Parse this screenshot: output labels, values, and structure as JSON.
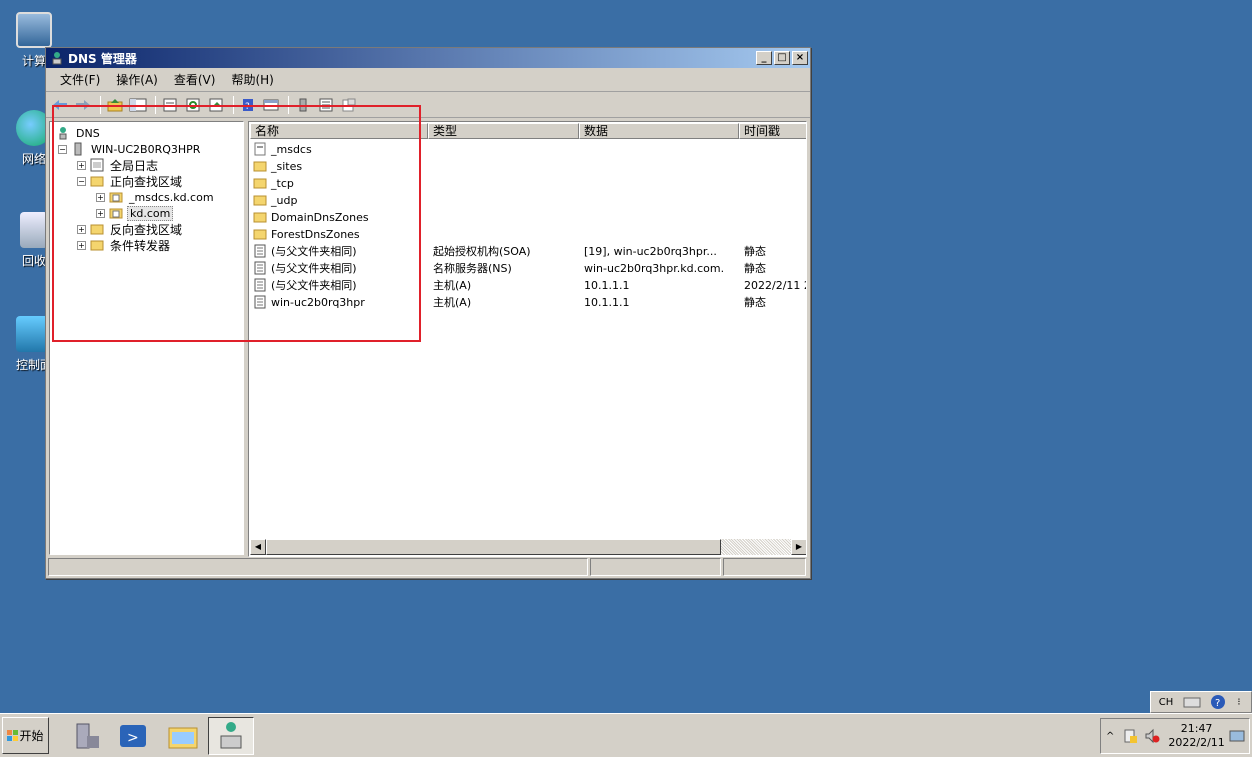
{
  "desktop": {
    "icons": [
      {
        "label": "计算"
      },
      {
        "label": "网络"
      },
      {
        "label": "回收"
      },
      {
        "label": "控制面"
      }
    ]
  },
  "window": {
    "title": "DNS 管理器",
    "menu": [
      "文件(F)",
      "操作(A)",
      "查看(V)",
      "帮助(H)"
    ]
  },
  "tree": {
    "root": "DNS",
    "server": "WIN-UC2B0RQ3HPR",
    "global_logs": "全局日志",
    "forward_zones": "正向查找区域",
    "msdcs_zone": "_msdcs.kd.com",
    "kd_zone": "kd.com",
    "reverse_zones": "反向查找区域",
    "conditional_forwarders": "条件转发器"
  },
  "list": {
    "columns": [
      "名称",
      "类型",
      "数据",
      "时间戳"
    ],
    "rows": [
      {
        "name": "_msdcs",
        "type": "",
        "data": "",
        "ts": "",
        "icon": "zone"
      },
      {
        "name": "_sites",
        "type": "",
        "data": "",
        "ts": "",
        "icon": "folder"
      },
      {
        "name": "_tcp",
        "type": "",
        "data": "",
        "ts": "",
        "icon": "folder"
      },
      {
        "name": "_udp",
        "type": "",
        "data": "",
        "ts": "",
        "icon": "folder"
      },
      {
        "name": "DomainDnsZones",
        "type": "",
        "data": "",
        "ts": "",
        "icon": "folder"
      },
      {
        "name": "ForestDnsZones",
        "type": "",
        "data": "",
        "ts": "",
        "icon": "folder"
      },
      {
        "name": "(与父文件夹相同)",
        "type": "起始授权机构(SOA)",
        "data": "[19], win-uc2b0rq3hpr...",
        "ts": "静态",
        "icon": "record"
      },
      {
        "name": "(与父文件夹相同)",
        "type": "名称服务器(NS)",
        "data": "win-uc2b0rq3hpr.kd.com.",
        "ts": "静态",
        "icon": "record"
      },
      {
        "name": "(与父文件夹相同)",
        "type": "主机(A)",
        "data": "10.1.1.1",
        "ts": "2022/2/11 2",
        "icon": "record"
      },
      {
        "name": "win-uc2b0rq3hpr",
        "type": "主机(A)",
        "data": "10.1.1.1",
        "ts": "静态",
        "icon": "record"
      }
    ]
  },
  "langbar": {
    "lang": "CH"
  },
  "taskbar": {
    "start": "开始",
    "clock_time": "21:47",
    "clock_date": "2022/2/11"
  },
  "colors": {
    "desktop": "#3a6ea5",
    "titlebar_start": "#0a246a",
    "highlight": "#e0202a"
  }
}
